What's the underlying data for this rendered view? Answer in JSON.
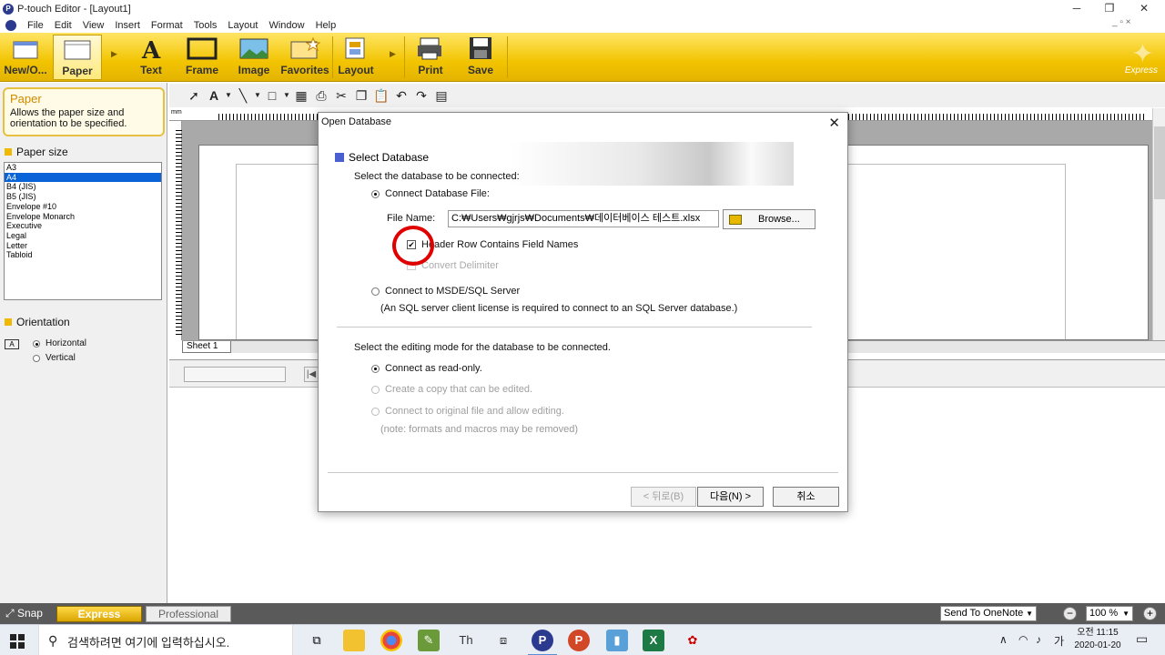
{
  "window": {
    "title": "P-touch Editor - [Layout1]",
    "minimize": "─",
    "maximize": "❐",
    "close": "✕",
    "mdi_controls": "_ ▫ ×"
  },
  "menu": [
    "File",
    "Edit",
    "View",
    "Insert",
    "Format",
    "Tools",
    "Layout",
    "Window",
    "Help"
  ],
  "ribbon": {
    "buttons": {
      "new_open": "New/O...",
      "paper": "Paper",
      "text": "Text",
      "frame": "Frame",
      "image": "Image",
      "favorites": "Favorites",
      "layout": "Layout",
      "print": "Print",
      "save": "Save"
    },
    "brand": "Express"
  },
  "left_panel": {
    "tip_title": "Paper",
    "tip_text": "Allows the paper size and orientation to be specified.",
    "paper_size_heading": "Paper size",
    "paper_sizes": [
      "A3",
      "A4",
      "B4 (JIS)",
      "B5 (JIS)",
      "Envelope #10",
      "Envelope Monarch",
      "Executive",
      "Legal",
      "Letter",
      "Tabloid"
    ],
    "selected_size": "A4",
    "orientation_heading": "Orientation",
    "orientation_icon": "A",
    "orientation_options": [
      "Horizontal",
      "Vertical"
    ],
    "selected_orientation": "Horizontal"
  },
  "ruler": {
    "unit": "mm"
  },
  "sheet_tab": "Sheet 1",
  "dialog": {
    "title": "Open Database",
    "section_heading": "Select Database",
    "prompt_connect": "Select the database to be connected:",
    "option_file": "Connect Database File:",
    "file_name_label": "File Name:",
    "file_name_value": "C:₩Users₩gjrjs₩Documents₩데이터베이스 테스트.xlsx",
    "browse_label": "Browse...",
    "header_row_label": "Header Row Contains Field Names",
    "header_row_checked": true,
    "convert_delimiter_label": "Convert Delimiter",
    "option_sql": "Connect to MSDE/SQL Server",
    "sql_note": "(An SQL server client license is required to connect to an SQL Server database.)",
    "prompt_mode": "Select the editing mode for the database to be connected.",
    "mode_readonly": "Connect as read-only.",
    "mode_copy": "Create a copy that can be edited.",
    "mode_original": "Connect to original file and allow editing.",
    "mode_note": "(note:  formats and macros may be removed)",
    "btn_back": "< 뒤로(B)",
    "btn_next": "다음(N) >",
    "btn_cancel": "취소"
  },
  "statusbar": {
    "snap": "Snap",
    "express": "Express",
    "professional": "Professional",
    "send_to": "Send To OneNote",
    "zoom": "100 %"
  },
  "taskbar": {
    "search_placeholder": "검색하려면 여기에 입력하십시오.",
    "ime": "가",
    "time": "오전 11:15",
    "date": "2020-01-20"
  },
  "colors": {
    "ribbon_yellow": "#f2c400",
    "highlight_red": "#e00000",
    "selection_blue": "#0a64d8"
  }
}
